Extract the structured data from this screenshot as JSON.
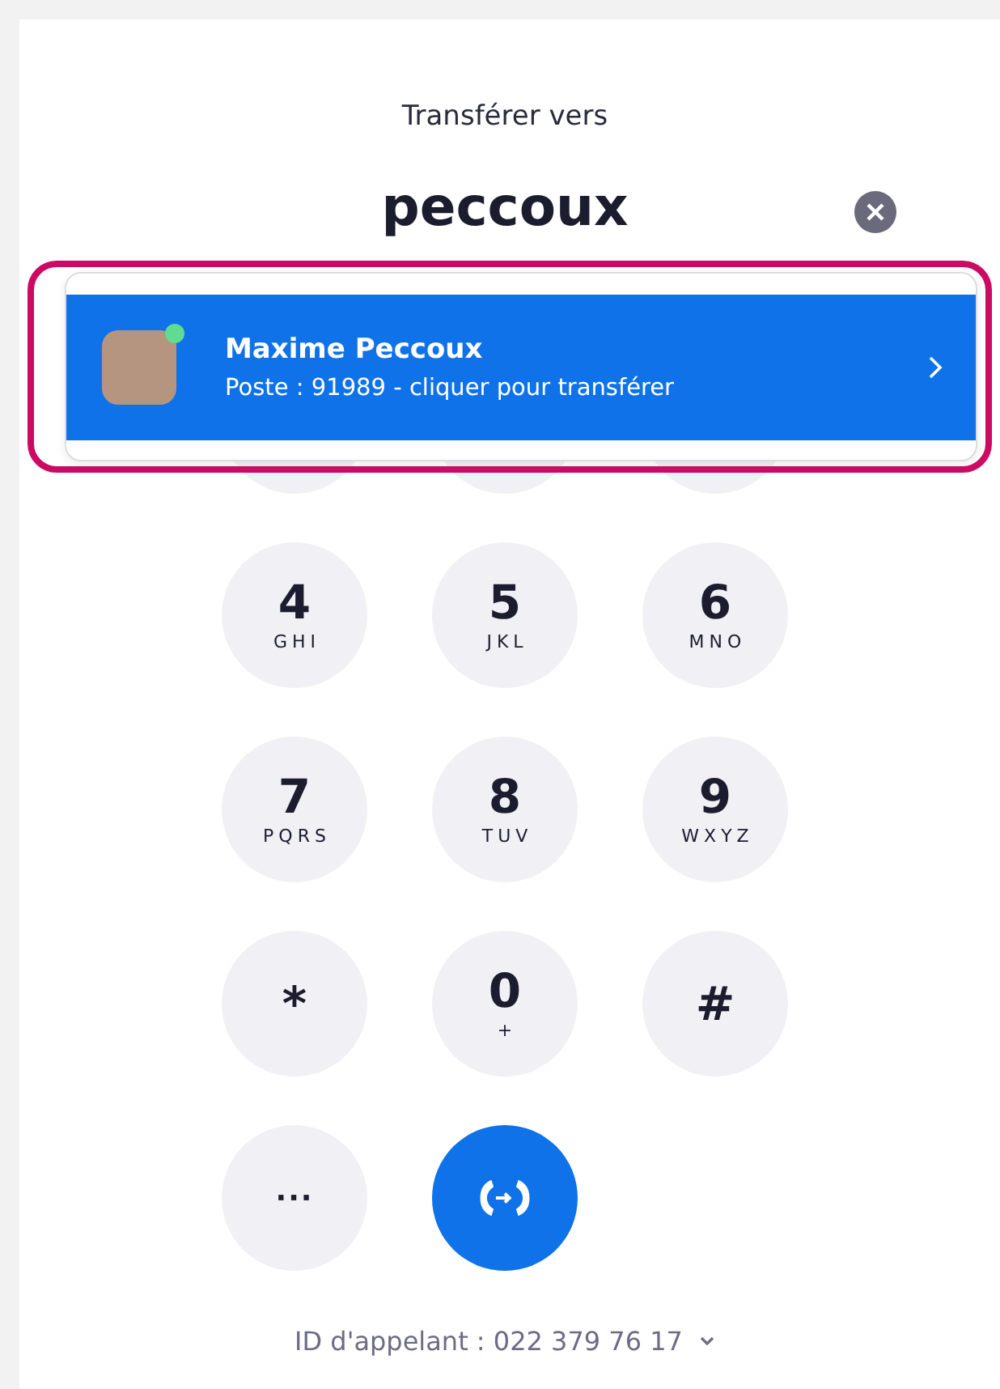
{
  "title": "Transférer vers",
  "search": {
    "value": "peccoux"
  },
  "results": [
    {
      "name": "Maxime Peccoux",
      "detail": "Poste : 91989 - cliquer pour transférer",
      "online": true,
      "selected": true,
      "highlighted": true
    }
  ],
  "keys": [
    {
      "kind": "covered"
    },
    {
      "kind": "covered"
    },
    {
      "kind": "covered"
    },
    {
      "kind": "digit",
      "digit": "4",
      "letters": "GHI"
    },
    {
      "kind": "digit",
      "digit": "5",
      "letters": "JKL"
    },
    {
      "kind": "digit",
      "digit": "6",
      "letters": "MNO"
    },
    {
      "kind": "digit",
      "digit": "7",
      "letters": "PQRS"
    },
    {
      "kind": "digit",
      "digit": "8",
      "letters": "TUV"
    },
    {
      "kind": "digit",
      "digit": "9",
      "letters": "WXYZ"
    },
    {
      "kind": "digit",
      "digit": "*"
    },
    {
      "kind": "digit",
      "digit": "0",
      "letters": "+"
    },
    {
      "kind": "digit",
      "digit": "#"
    },
    {
      "kind": "more",
      "digit": "···"
    },
    {
      "kind": "transfer"
    }
  ],
  "caller_id": "ID d'appelant : 022 379 76 17"
}
